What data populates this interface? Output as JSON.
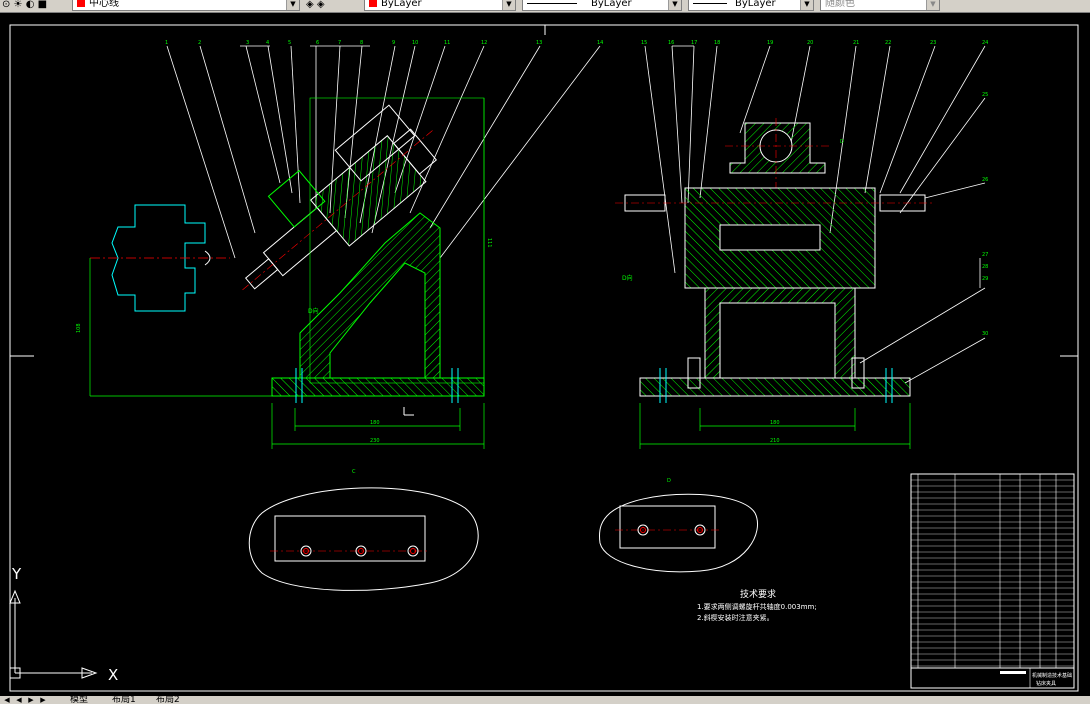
{
  "toolbar": {
    "layer_name": "中心线",
    "color_combo": "ByLayer",
    "linetype_combo": "ByLayer",
    "lineweight_combo": "ByLayer",
    "plotstyle_combo": "随颜色"
  },
  "drawing": {
    "tech_title": "技术要求",
    "tech_line1": "1.要求两侧调螺旋杆共轴度0.003mm;",
    "tech_line2": "2.斜楔安装时注意夹紧。",
    "view_d": "D向",
    "view_d2": "D向",
    "section_c": "C",
    "section_d": "D",
    "dim_180_left": "180",
    "dim_230_left": "230",
    "dim_180_right": "180",
    "dim_210_right": "210",
    "dim_108": "108",
    "dim_111": "111",
    "title_block": "机械制造技术基础",
    "title_block2": "钻床夹具",
    "balloons_left": [
      "1",
      "2",
      "3",
      "4",
      "5",
      "6",
      "7",
      "8",
      "9",
      "10",
      "11",
      "12",
      "13",
      "14"
    ],
    "balloons_right": [
      "15",
      "16",
      "17",
      "18",
      "19",
      "20",
      "21",
      "22",
      "23",
      "24",
      "25",
      "26",
      "27",
      "28",
      "29",
      "30"
    ],
    "ucs_x": "X",
    "ucs_y": "Y",
    "colors": {
      "geometry": "#00ff00",
      "text": "#ffffff",
      "cyan": "#00ffff",
      "red": "#ff0000",
      "background": "#000000"
    }
  },
  "tabs": {
    "model": "模型",
    "layout1": "布局1",
    "layout2": "布局2"
  }
}
